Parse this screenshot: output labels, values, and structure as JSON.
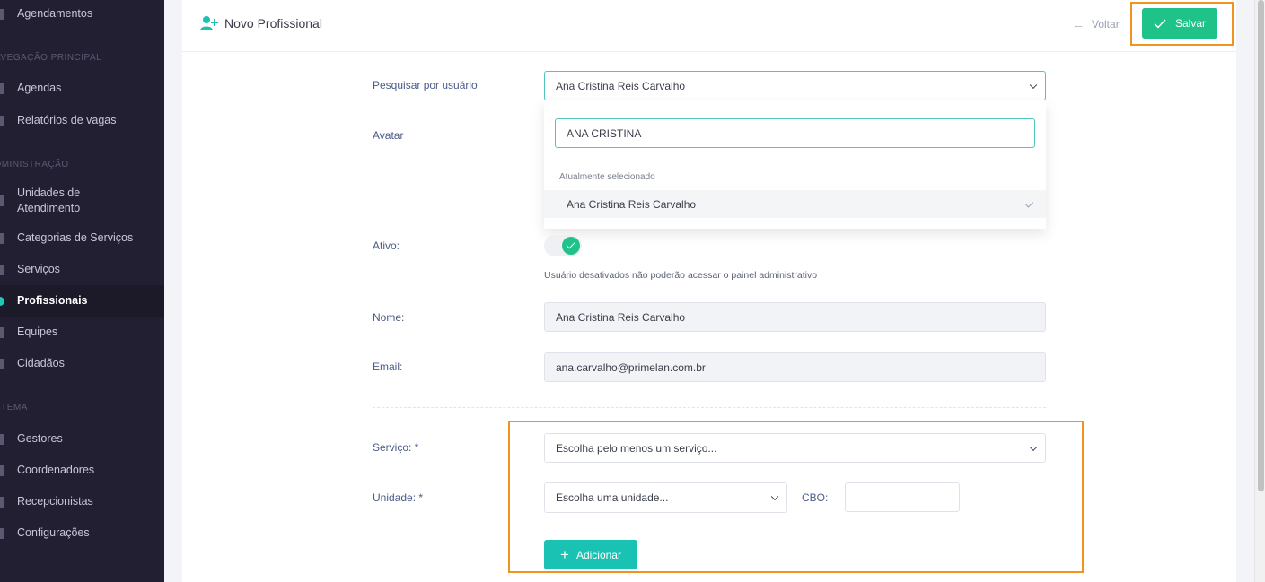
{
  "sidebar": {
    "top_item": "Agendamentos",
    "sections": [
      {
        "title": "AVEGAÇÃO PRINCIPAL",
        "items": [
          "Agendas",
          "Relatórios de vagas"
        ]
      },
      {
        "title": "DMINISTRAÇÃO",
        "items": [
          "Unidades de Atendimento",
          "Categorias de Serviços",
          "Serviços",
          "Profissionais",
          "Equipes",
          "Cidadãos"
        ]
      },
      {
        "title": "STEMA",
        "items": [
          "Gestores",
          "Coordenadores",
          "Recepcionistas",
          "Configurações"
        ]
      }
    ],
    "active": "Profissionais"
  },
  "header": {
    "title": "Novo Profissional",
    "back_label": "Voltar",
    "save_label": "Salvar"
  },
  "form": {
    "search_label": "Pesquisar por usuário",
    "search_value": "Ana Cristina Reis Carvalho",
    "dropdown": {
      "query": "ANA CRISTINA",
      "group_label": "Atualmente selecionado",
      "option": "Ana Cristina Reis Carvalho"
    },
    "avatar_label": "Avatar",
    "active_label": "Ativo:",
    "active_help": "Usuário desativados não poderão acessar o painel administrativo",
    "name_label": "Nome:",
    "name_value": "Ana Cristina Reis Carvalho",
    "email_label": "Email:",
    "email_value": "ana.carvalho@primelan.com.br",
    "service_label": "Serviço: *",
    "service_placeholder": "Escolha pelo menos um serviço...",
    "unit_label": "Unidade: *",
    "unit_placeholder": "Escolha uma unidade...",
    "cbo_label": "CBO:",
    "cbo_value": "",
    "add_label": "Adicionar"
  },
  "colors": {
    "sidebar_bg": "#231f33",
    "accent_teal": "#19c2b3",
    "save_green": "#1fc38a",
    "highlight_orange": "#f0931f"
  }
}
